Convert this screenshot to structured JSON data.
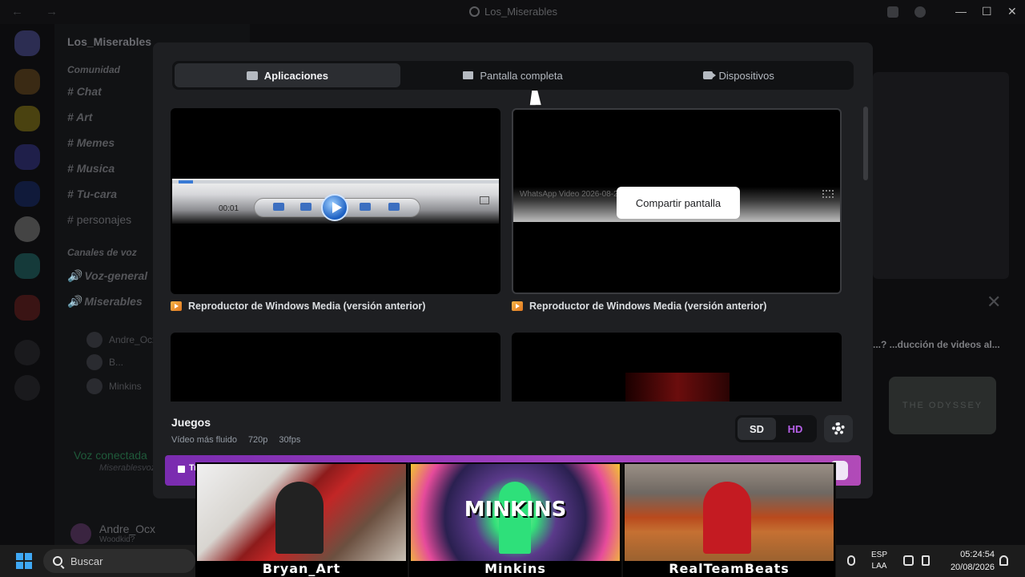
{
  "window": {
    "title": "Los_Miserables"
  },
  "sidebar": {
    "server_name": "Los_Miserables",
    "channels": [
      {
        "label": "Comunidad",
        "kind": "category"
      },
      {
        "label": "Chat",
        "kind": "text"
      },
      {
        "label": "Art",
        "kind": "text"
      },
      {
        "label": "Memes",
        "kind": "text"
      },
      {
        "label": "Musica",
        "kind": "text"
      },
      {
        "label": "Tu-cara",
        "kind": "text"
      },
      {
        "label": "personajes",
        "kind": "text"
      },
      {
        "label": "Canales de voz",
        "kind": "category"
      },
      {
        "label": "Voz-general",
        "kind": "voice"
      },
      {
        "label": "Miserables",
        "kind": "voice"
      }
    ],
    "voice_members": [
      "Andre_Ocx",
      "B...",
      "Minkins"
    ],
    "voice_status": "Voz conectada",
    "voice_channel": "Miserablesvoz / Lo...",
    "user": {
      "name": "Andre_Ocx",
      "status": "Woodkid?"
    }
  },
  "background_panel": {
    "promo_text": "...? ...ducción de videos al...",
    "promo_card": "THE ODYSSEY"
  },
  "modal": {
    "tabs": [
      {
        "label": "Aplicaciones",
        "icon": "app-window-icon",
        "active": true
      },
      {
        "label": "Pantalla completa",
        "icon": "monitor-icon",
        "active": false
      },
      {
        "label": "Dispositivos",
        "icon": "camera-icon",
        "active": false
      }
    ],
    "sources": [
      {
        "label": "Reproductor de Windows Media (versión anterior)",
        "player_time": "00:01"
      },
      {
        "label": "Reproductor de Windows Media (versión anterior)",
        "video_title": "WhatsApp Video 2026-08-2...",
        "hover_button": "Compartir pantalla"
      }
    ],
    "quality": {
      "heading": "Juegos",
      "subtitle": "Vídeo más fluido",
      "resolution": "720p",
      "fps": "30fps",
      "sd_label": "SD",
      "hd_label": "HD",
      "selected": "SD"
    },
    "nitro_banner": "Tr..."
  },
  "webcams": [
    {
      "name": "Bryan_Art"
    },
    {
      "name": "Minkins",
      "logo": "MINKINS"
    },
    {
      "name": "RealTeamBeats"
    }
  ],
  "taskbar": {
    "search_placeholder": "Buscar",
    "lang_top": "ESP",
    "lang_bottom": "LAA",
    "time": "05:24:54",
    "date": "20/08/2026"
  },
  "colors": {
    "modal_bg": "#1e1f22",
    "hd_accent": "#b660e8",
    "nitro_banner": "#a342c0",
    "windows_accent": "#3fa8f5"
  }
}
